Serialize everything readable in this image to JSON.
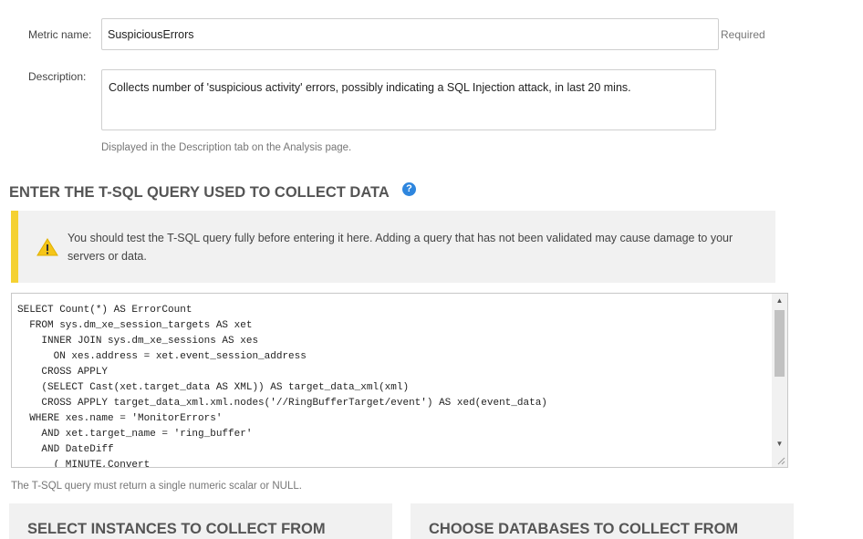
{
  "metric": {
    "name_label": "Metric name:",
    "name_value": "SuspiciousErrors",
    "name_required": "Required",
    "description_label": "Description:",
    "description_value": "Collects number of 'suspicious activity' errors, possibly indicating a SQL Injection attack, in last 20 mins.",
    "description_hint": "Displayed in the Description tab on the Analysis page."
  },
  "query_section": {
    "title": "ENTER THE T-SQL QUERY USED TO COLLECT DATA",
    "help_icon": "question-circle-icon",
    "warning_icon": "warning-triangle-icon",
    "warning_text": "You should test the T-SQL query fully before entering it here. Adding a query that has not been validated may cause damage to your servers or data.",
    "sql": "SELECT Count(*) AS ErrorCount\n  FROM sys.dm_xe_session_targets AS xet\n    INNER JOIN sys.dm_xe_sessions AS xes\n      ON xes.address = xet.event_session_address\n    CROSS APPLY\n    (SELECT Cast(xet.target_data AS XML)) AS target_data_xml(xml)\n    CROSS APPLY target_data_xml.xml.nodes('//RingBufferTarget/event') AS xed(event_data)\n  WHERE xes.name = 'MonitorErrors'\n    AND xet.target_name = 'ring_buffer'\n    AND DateDiff\n      ( MINUTE,Convert",
    "hint": "The T-SQL query must return a single numeric scalar or NULL."
  },
  "panels": {
    "instances_title": "SELECT INSTANCES TO COLLECT FROM",
    "databases_title": "CHOOSE DATABASES TO COLLECT FROM"
  },
  "colors": {
    "warning_accent": "#f5d132",
    "help_blue": "#2e86de",
    "panel_bg": "#f1f1f1"
  }
}
